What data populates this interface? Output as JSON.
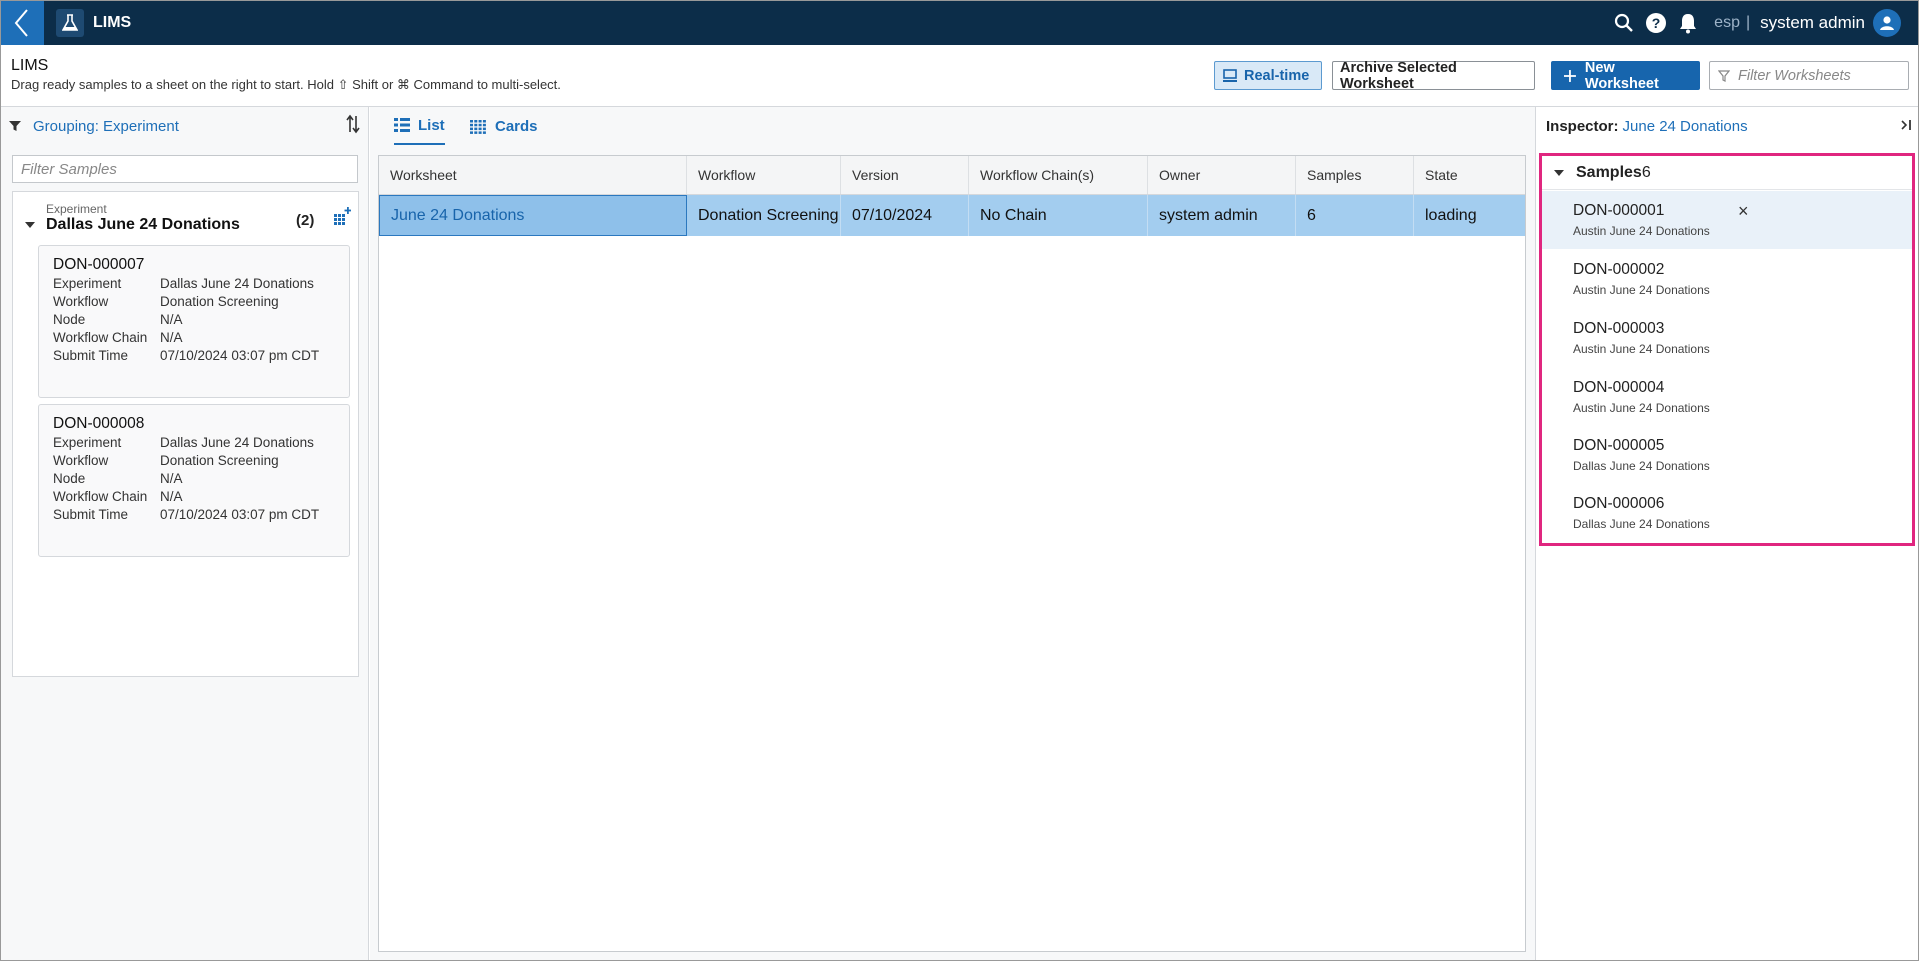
{
  "topbar": {
    "app_title": "LIMS",
    "lang": "esp",
    "separator": "|",
    "user_name": "system admin"
  },
  "header": {
    "title": "LIMS",
    "subtitle": "Drag ready samples to a sheet on the right to start. Hold ⇧ Shift or ⌘ Command to multi-select.",
    "realtime_label": "Real-time",
    "archive_label": "Archive Selected Worksheet",
    "new_label": "New Worksheet",
    "filter_placeholder": "Filter Worksheets"
  },
  "left": {
    "grouping_label": "Grouping: Experiment",
    "filter_placeholder": "Filter Samples",
    "group": {
      "caption": "Experiment",
      "name": "Dallas June 24 Donations",
      "count": "(2)"
    },
    "cards": [
      {
        "id": "DON-000007",
        "fields": [
          {
            "k": "Experiment",
            "v": "Dallas June 24 Donations"
          },
          {
            "k": "Workflow",
            "v": "Donation Screening"
          },
          {
            "k": "Node",
            "v": "N/A"
          },
          {
            "k": "Workflow Chain",
            "v": "N/A"
          },
          {
            "k": "Submit Time",
            "v": "07/10/2024 03:07 pm CDT"
          }
        ]
      },
      {
        "id": "DON-000008",
        "fields": [
          {
            "k": "Experiment",
            "v": "Dallas June 24 Donations"
          },
          {
            "k": "Workflow",
            "v": "Donation Screening"
          },
          {
            "k": "Node",
            "v": "N/A"
          },
          {
            "k": "Workflow Chain",
            "v": "N/A"
          },
          {
            "k": "Submit Time",
            "v": "07/10/2024 03:07 pm CDT"
          }
        ]
      }
    ]
  },
  "center": {
    "tabs": [
      {
        "label": "List"
      },
      {
        "label": "Cards"
      }
    ],
    "columns": [
      "Worksheet",
      "Workflow",
      "Version",
      "Workflow Chain(s)",
      "Owner",
      "Samples",
      "State"
    ],
    "rows": [
      [
        "June 24 Donations",
        "Donation Screening",
        "07/10/2024",
        "No Chain",
        "system admin",
        "6",
        "loading"
      ]
    ]
  },
  "inspector": {
    "label": "Inspector:",
    "value": "June 24 Donations",
    "samples_title": "Samples",
    "samples_count": "6",
    "samples": [
      {
        "id": "DON-000001",
        "exp": "Austin June 24 Donations"
      },
      {
        "id": "DON-000002",
        "exp": "Austin June 24 Donations"
      },
      {
        "id": "DON-000003",
        "exp": "Austin June 24 Donations"
      },
      {
        "id": "DON-000004",
        "exp": "Austin June 24 Donations"
      },
      {
        "id": "DON-000005",
        "exp": "Dallas June 24 Donations"
      },
      {
        "id": "DON-000006",
        "exp": "Dallas June 24 Donations"
      }
    ],
    "remove_symbol": "×"
  }
}
